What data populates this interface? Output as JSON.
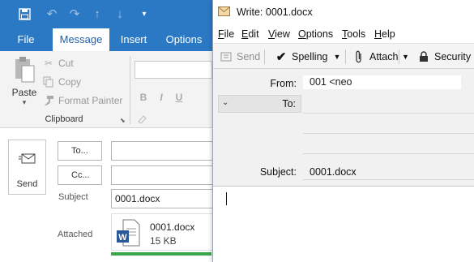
{
  "outlook": {
    "tabs": [
      "File",
      "Message",
      "Insert",
      "Options"
    ],
    "active_tab": "Message",
    "clipboard": {
      "paste_label": "Paste",
      "cut_label": "Cut",
      "copy_label": "Copy",
      "format_painter_label": "Format Painter",
      "group_label": "Clipboard"
    },
    "compose": {
      "send_label": "Send",
      "to_button": "To...",
      "cc_button": "Cc...",
      "subject_label": "Subject",
      "subject_value": "0001.docx",
      "attached_label": "Attached",
      "attachment": {
        "name": "0001.docx",
        "size": "15 KB",
        "icon_letter": "W"
      }
    },
    "colors": {
      "brand_blue": "#2b79c4",
      "word_blue": "#2b5797",
      "highlight_green": "#3aa64a"
    }
  },
  "write": {
    "title": "Write: 0001.docx",
    "menu": [
      {
        "label": "File",
        "accel": "F",
        "rest": "ile"
      },
      {
        "label": "Edit",
        "accel": "E",
        "rest": "dit"
      },
      {
        "label": "View",
        "accel": "V",
        "rest": "iew"
      },
      {
        "label": "Options",
        "accel": "O",
        "rest": "ptions"
      },
      {
        "label": "Tools",
        "accel": "T",
        "rest": "ools"
      },
      {
        "label": "Help",
        "accel": "H",
        "rest": "elp"
      }
    ],
    "toolbar": {
      "send_label": "Send",
      "spelling_label": "Spelling",
      "attach_label": "Attach",
      "security_label": "Security"
    },
    "header": {
      "from_label": "From:",
      "from_value": "001 <neo",
      "to_label": "To:",
      "subject_label": "Subject:",
      "subject_value": "0001.docx"
    }
  }
}
